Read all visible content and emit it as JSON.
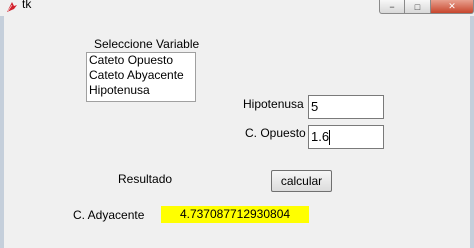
{
  "window": {
    "title": "tk",
    "controls": {
      "minimize": "−",
      "maximize": "□",
      "close": "✕"
    },
    "icon": "tk-feather-icon"
  },
  "variable_selector": {
    "label": "Seleccione Variable",
    "options": [
      "Cateto Opuesto",
      "Cateto Abyacente",
      "Hipotenusa"
    ]
  },
  "inputs": {
    "hipotenusa": {
      "label": "Hipotenusa",
      "value": "5"
    },
    "opuesto": {
      "label": "C. Opuesto",
      "value": "1.6"
    }
  },
  "resultado_label": "Resultado",
  "calcular_button": "calcular",
  "output": {
    "label": "C. Adyacente",
    "value": "4.737087712930804",
    "highlight_color": "#ffff00"
  }
}
